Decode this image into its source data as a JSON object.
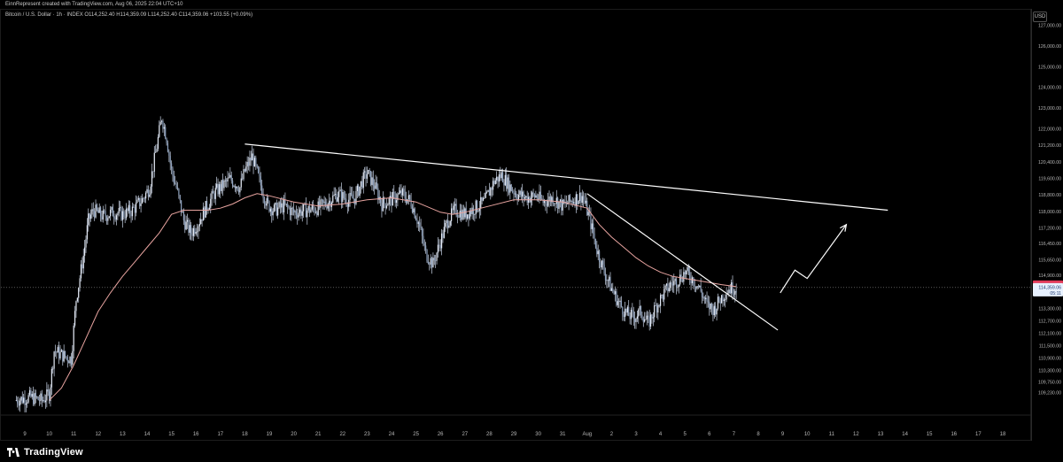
{
  "header": {
    "credit": "EinnRepresent created with TradingView.com, Aug 06, 2025 22:04 UTC+10",
    "symbol_info": "Bitcoin / U.S. Dollar · 1h · INDEX  O114,252.40  H114,359.09  L114,252.40  C114,359.06  +103.55 (+0.09%)",
    "currency": "USD"
  },
  "footer": {
    "brand": "TradingView"
  },
  "colors": {
    "candles": "#c8d3e6",
    "ma": "#e8a4a0",
    "trendline": "#ffffff",
    "price_tag_bg": "#e23b5a",
    "price_tag2_bg": "#e8f1ff"
  },
  "chart_data": {
    "type": "candlestick",
    "ylim": [
      108700,
      127800
    ],
    "y_ticks": [
      127000,
      126000,
      125000,
      124000,
      123000,
      122000,
      121200,
      120400,
      119600,
      118800,
      118000,
      117200,
      116450,
      115650,
      114900,
      114100,
      113300,
      112700,
      112100,
      111500,
      110900,
      110300,
      109750,
      109230
    ],
    "x_ticks": [
      {
        "label": "9",
        "t": 9
      },
      {
        "label": "10",
        "t": 10
      },
      {
        "label": "11",
        "t": 11
      },
      {
        "label": "12",
        "t": 12
      },
      {
        "label": "13",
        "t": 13
      },
      {
        "label": "14",
        "t": 14
      },
      {
        "label": "15",
        "t": 15
      },
      {
        "label": "16",
        "t": 16
      },
      {
        "label": "17",
        "t": 17
      },
      {
        "label": "18",
        "t": 18
      },
      {
        "label": "19",
        "t": 19
      },
      {
        "label": "20",
        "t": 20
      },
      {
        "label": "21",
        "t": 21
      },
      {
        "label": "22",
        "t": 22
      },
      {
        "label": "23",
        "t": 23
      },
      {
        "label": "24",
        "t": 24
      },
      {
        "label": "25",
        "t": 25
      },
      {
        "label": "26",
        "t": 26
      },
      {
        "label": "27",
        "t": 27
      },
      {
        "label": "28",
        "t": 28
      },
      {
        "label": "29",
        "t": 29
      },
      {
        "label": "30",
        "t": 30
      },
      {
        "label": "31",
        "t": 31
      },
      {
        "label": "Aug",
        "t": 32
      },
      {
        "label": "2",
        "t": 33
      },
      {
        "label": "3",
        "t": 34
      },
      {
        "label": "4",
        "t": 35
      },
      {
        "label": "5",
        "t": 36
      },
      {
        "label": "6",
        "t": 37
      },
      {
        "label": "7",
        "t": 38
      },
      {
        "label": "8",
        "t": 39
      },
      {
        "label": "9",
        "t": 40
      },
      {
        "label": "10",
        "t": 41
      },
      {
        "label": "11",
        "t": 42
      },
      {
        "label": "12",
        "t": 43
      },
      {
        "label": "13",
        "t": 44
      },
      {
        "label": "14",
        "t": 45
      },
      {
        "label": "15",
        "t": 46
      },
      {
        "label": "16",
        "t": 47
      },
      {
        "label": "17",
        "t": 48
      },
      {
        "label": "18",
        "t": 49
      }
    ],
    "price_path": [
      [
        8.6,
        108900
      ],
      [
        9.2,
        109050
      ],
      [
        9.7,
        108900
      ],
      [
        10.0,
        109200
      ],
      [
        10.2,
        111300
      ],
      [
        10.5,
        111100
      ],
      [
        10.9,
        110900
      ],
      [
        11.1,
        113800
      ],
      [
        11.4,
        115900
      ],
      [
        11.6,
        117600
      ],
      [
        11.8,
        118100
      ],
      [
        12.2,
        117800
      ],
      [
        12.6,
        118000
      ],
      [
        13.0,
        117900
      ],
      [
        13.4,
        118100
      ],
      [
        13.8,
        118600
      ],
      [
        14.1,
        119200
      ],
      [
        14.4,
        121200
      ],
      [
        14.6,
        122600
      ],
      [
        14.8,
        121600
      ],
      [
        15.0,
        120000
      ],
      [
        15.2,
        119200
      ],
      [
        15.5,
        117600
      ],
      [
        15.8,
        117000
      ],
      [
        16.1,
        117500
      ],
      [
        16.4,
        118200
      ],
      [
        16.8,
        119000
      ],
      [
        17.1,
        119300
      ],
      [
        17.4,
        119600
      ],
      [
        17.8,
        119200
      ],
      [
        18.0,
        120000
      ],
      [
        18.3,
        120700
      ],
      [
        18.6,
        119500
      ],
      [
        18.9,
        118400
      ],
      [
        19.2,
        118100
      ],
      [
        19.6,
        118300
      ],
      [
        20.0,
        118000
      ],
      [
        20.5,
        118100
      ],
      [
        21.0,
        118200
      ],
      [
        21.4,
        118500
      ],
      [
        21.8,
        118900
      ],
      [
        22.2,
        118600
      ],
      [
        22.5,
        118700
      ],
      [
        22.8,
        119500
      ],
      [
        23.0,
        119900
      ],
      [
        23.3,
        119300
      ],
      [
        23.6,
        118400
      ],
      [
        24.0,
        118600
      ],
      [
        24.4,
        118900
      ],
      [
        24.8,
        118500
      ],
      [
        25.1,
        117500
      ],
      [
        25.4,
        116000
      ],
      [
        25.7,
        115500
      ],
      [
        26.0,
        116600
      ],
      [
        26.3,
        117600
      ],
      [
        26.6,
        118100
      ],
      [
        27.0,
        117900
      ],
      [
        27.4,
        118200
      ],
      [
        27.8,
        118500
      ],
      [
        28.2,
        119500
      ],
      [
        28.5,
        119800
      ],
      [
        28.8,
        119300
      ],
      [
        29.1,
        118900
      ],
      [
        29.5,
        118700
      ],
      [
        29.9,
        118800
      ],
      [
        30.2,
        118500
      ],
      [
        30.6,
        118700
      ],
      [
        31.0,
        118300
      ],
      [
        31.4,
        118600
      ],
      [
        31.8,
        118800
      ],
      [
        32.1,
        117700
      ],
      [
        32.4,
        116200
      ],
      [
        32.7,
        115100
      ],
      [
        33.0,
        114300
      ],
      [
        33.3,
        113600
      ],
      [
        33.6,
        113100
      ],
      [
        33.9,
        112900
      ],
      [
        34.2,
        113200
      ],
      [
        34.5,
        112600
      ],
      [
        34.8,
        113400
      ],
      [
        35.1,
        114000
      ],
      [
        35.4,
        114500
      ],
      [
        35.7,
        114700
      ],
      [
        36.0,
        115100
      ],
      [
        36.3,
        114800
      ],
      [
        36.6,
        114300
      ],
      [
        36.9,
        113500
      ],
      [
        37.2,
        113300
      ],
      [
        37.5,
        113900
      ],
      [
        37.8,
        114300
      ],
      [
        38.1,
        114360
      ]
    ],
    "ma_path": [
      [
        10.0,
        108900
      ],
      [
        10.5,
        109500
      ],
      [
        11.0,
        110600
      ],
      [
        11.5,
        111900
      ],
      [
        12.0,
        113200
      ],
      [
        12.5,
        114100
      ],
      [
        13.0,
        114900
      ],
      [
        13.5,
        115600
      ],
      [
        14.0,
        116300
      ],
      [
        14.5,
        117000
      ],
      [
        15.0,
        117900
      ],
      [
        15.5,
        118100
      ],
      [
        16.0,
        118100
      ],
      [
        16.5,
        118100
      ],
      [
        17.0,
        118200
      ],
      [
        17.5,
        118400
      ],
      [
        18.0,
        118700
      ],
      [
        18.5,
        118900
      ],
      [
        19.0,
        118800
      ],
      [
        20.0,
        118500
      ],
      [
        21.0,
        118300
      ],
      [
        22.0,
        118400
      ],
      [
        23.0,
        118600
      ],
      [
        24.0,
        118700
      ],
      [
        25.0,
        118500
      ],
      [
        26.0,
        118000
      ],
      [
        26.5,
        117900
      ],
      [
        27.0,
        118000
      ],
      [
        28.0,
        118300
      ],
      [
        29.0,
        118600
      ],
      [
        30.0,
        118600
      ],
      [
        31.0,
        118500
      ],
      [
        32.0,
        118200
      ],
      [
        32.5,
        117400
      ],
      [
        33.0,
        116800
      ],
      [
        33.5,
        116300
      ],
      [
        34.0,
        115800
      ],
      [
        34.5,
        115400
      ],
      [
        35.0,
        115100
      ],
      [
        35.5,
        114900
      ],
      [
        36.0,
        114800
      ],
      [
        36.5,
        114700
      ],
      [
        37.0,
        114600
      ],
      [
        37.5,
        114500
      ],
      [
        38.1,
        114400
      ]
    ],
    "trendlines": [
      {
        "name": "upper-resistance",
        "points": [
          [
            18.0,
            121300
          ],
          [
            44.3,
            118100
          ]
        ]
      },
      {
        "name": "descending-resistance",
        "points": [
          [
            32.0,
            118900
          ],
          [
            39.8,
            112300
          ]
        ]
      }
    ],
    "projection": [
      [
        39.9,
        114100
      ],
      [
        40.5,
        115200
      ],
      [
        41.0,
        114800
      ],
      [
        42.6,
        117400
      ]
    ],
    "last_price": 114441.41,
    "current_price": 114359.06,
    "countdown": "05:11",
    "grid": false,
    "legend": "none"
  }
}
